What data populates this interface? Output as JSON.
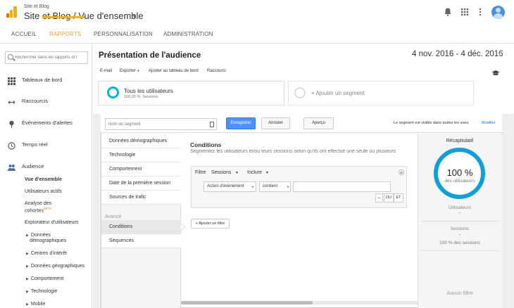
{
  "header": {
    "account": "Site et Blog",
    "title": "Site et Blog / Vue d'ensemble",
    "icons": [
      "bell-icon",
      "apps-grid-icon",
      "more-vert-icon",
      "avatar"
    ]
  },
  "nav_tabs": [
    {
      "label": "ACCUEIL",
      "active": false
    },
    {
      "label": "RAPPORTS",
      "active": true
    },
    {
      "label": "PERSONNALISATION",
      "active": false
    },
    {
      "label": "ADMINISTRATION",
      "active": false
    }
  ],
  "sidebar": {
    "search_placeholder": "Rechercher dans les rapports et l'",
    "items": [
      {
        "label": "Tableaux de bord",
        "icon": "dashboard-grid-icon"
      },
      {
        "label": "Raccourcis",
        "icon": "shortcut-arrows-icon"
      },
      {
        "label": "Événements d'alertes",
        "icon": "pin-icon"
      },
      {
        "label": "Temps réel",
        "icon": "clock-icon"
      },
      {
        "label": "Audience",
        "icon": "people-icon"
      }
    ],
    "audience_sub": [
      {
        "label": "Vue d'ensemble",
        "bold": true
      },
      {
        "label": "Utilisateurs actifs",
        "bold": false
      },
      {
        "label": "Analyse des",
        "bold": false
      },
      {
        "label": "cohortes",
        "badge": "BETA"
      },
      {
        "label": "Explorateur d'utilisateurs",
        "bold": false
      }
    ],
    "audience_tree": [
      {
        "label": "Données"
      },
      {
        "label": "démographiques"
      },
      {
        "label": "Centres d'intérêt"
      },
      {
        "label": "Données géographiques"
      },
      {
        "label": "Comportement"
      },
      {
        "label": "Technologie"
      },
      {
        "label": "Mobile"
      }
    ]
  },
  "report": {
    "title": "Présentation de l'audience",
    "date_range": "4 nov. 2016 - 4 déc. 2016",
    "toolbar": [
      "E-mail",
      "Exporter",
      "Ajouter au tableau de bord",
      "Raccourci"
    ],
    "segments": {
      "active_label": "Tous les utilisateurs",
      "active_sub": "100,00 %, Sessions",
      "add_label": "+ Ajouter un segment"
    }
  },
  "segment_editor": {
    "name_placeholder": "Nom du segment",
    "save_label": "Enregistrer",
    "cancel_label": "Annuler",
    "preview_label": "Aperçu",
    "visibility_note": "Le segment est visible dans toutes les vues.",
    "visibility_link": "Modifier",
    "categories": [
      "Données démographiques",
      "Technologie",
      "Comportement",
      "Date de la première session",
      "Sources de trafic"
    ],
    "advanced_label": "Avancé",
    "advanced_items": [
      "Conditions",
      "Séquences"
    ],
    "conditions": {
      "title": "Conditions",
      "description": "Segmentez les utilisateurs et/ou leurs sessions selon qu'ils ont effectué une seule ou plusieurs",
      "filter_label": "Filtre",
      "scope": "Sessions",
      "mode": "Inclure",
      "dimension": "Action d'événement",
      "operator": "contient",
      "value": "",
      "minus_label": "–",
      "or_label": "OU",
      "and_label": "ET",
      "add_filter_label": "+ Ajouter un filtre"
    },
    "summary": {
      "title": "Récapitulatif",
      "percent": "100 %",
      "percent_sub": "des utilisateurs",
      "users_label": "Utilisateurs",
      "users_value": "-",
      "sessions_label": "Sessions",
      "sessions_value": "-",
      "sessions_pct": "100 % des sessions",
      "no_filter": "Aucun filtre"
    }
  },
  "colors": {
    "accent_orange": "#f4b400",
    "primary_blue": "#4d90fe",
    "segment_teal": "#0cb0d9"
  }
}
